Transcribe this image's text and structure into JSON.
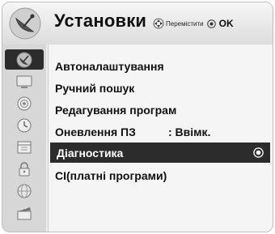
{
  "header": {
    "title": "Установки",
    "nav_hint": "Перемістити",
    "ok_label": "OK",
    "icon": "satellite-dish-icon"
  },
  "sidebar": {
    "items": [
      {
        "icon": "satellite-dish-icon",
        "active": true
      },
      {
        "icon": "tv-screen-icon",
        "active": false
      },
      {
        "icon": "speaker-icon",
        "active": false
      },
      {
        "icon": "clock-icon",
        "active": false
      },
      {
        "icon": "calendar-lock-icon",
        "active": false
      },
      {
        "icon": "padlock-icon",
        "active": false
      },
      {
        "icon": "globe-icon",
        "active": false
      },
      {
        "icon": "clapperboard-icon",
        "active": false
      }
    ]
  },
  "menu": {
    "items": [
      {
        "label": "Автоналаштування"
      },
      {
        "label": "Ручний пошук"
      },
      {
        "label": "Редагування програм"
      },
      {
        "label": "Оневлення ПЗ",
        "value": ": Ввімк."
      },
      {
        "label": "Діагностика",
        "selected": true
      },
      {
        "label": "CI(платні програми)"
      }
    ]
  },
  "colors": {
    "selected_background": "#2c2c2c",
    "selected_text": "#ffffff",
    "text": "#111111"
  }
}
